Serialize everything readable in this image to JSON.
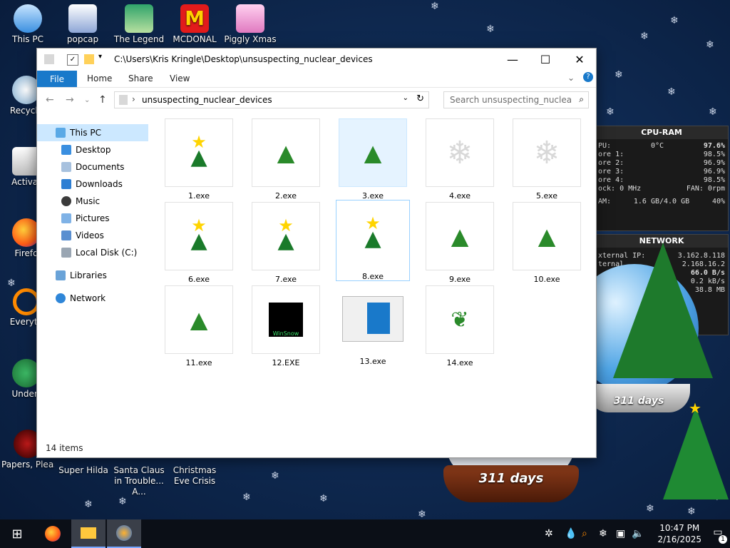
{
  "desktop_icons": [
    {
      "label": "This PC"
    },
    {
      "label": "popcap"
    },
    {
      "label": "The Legend"
    },
    {
      "label": "MCDONAL"
    },
    {
      "label": "Piggly Xmas"
    },
    {
      "label": "Recycle"
    },
    {
      "label": "Activat"
    },
    {
      "label": "Firefo"
    },
    {
      "label": "Everyth"
    },
    {
      "label": "Undert"
    },
    {
      "label": "Papers, Please"
    },
    {
      "label": "Super Hilda"
    },
    {
      "label": "Santa Claus in Trouble... A..."
    },
    {
      "label": "Christmas Eve Crisis"
    }
  ],
  "window": {
    "title_path": "C:\\Users\\Kris Kringle\\Desktop\\unsuspecting_nuclear_devices",
    "ribbon_tabs": [
      "File",
      "Home",
      "Share",
      "View"
    ],
    "address": "unsuspecting_nuclear_devices",
    "search_placeholder": "Search unsuspecting_nuclear_...",
    "nav": {
      "this_pc": "This PC",
      "desktop": "Desktop",
      "documents": "Documents",
      "downloads": "Downloads",
      "music": "Music",
      "pictures": "Pictures",
      "videos": "Videos",
      "local_disk": "Local Disk (C:)",
      "libraries": "Libraries",
      "network": "Network"
    },
    "files": [
      {
        "name": "1.exe",
        "icon": "star-tree"
      },
      {
        "name": "2.exe",
        "icon": "xmas-tree"
      },
      {
        "name": "3.exe",
        "icon": "xmas-tree"
      },
      {
        "name": "4.exe",
        "icon": "snowflake"
      },
      {
        "name": "5.exe",
        "icon": "snowflake"
      },
      {
        "name": "6.exe",
        "icon": "star-tree"
      },
      {
        "name": "7.exe",
        "icon": "star-tree"
      },
      {
        "name": "8.exe",
        "icon": "star-tree"
      },
      {
        "name": "9.exe",
        "icon": "xmas-tree"
      },
      {
        "name": "10.exe",
        "icon": "xmas-tree"
      },
      {
        "name": "11.exe",
        "icon": "xmas-tree"
      },
      {
        "name": "12.EXE",
        "icon": "winsnow"
      },
      {
        "name": "13.exe",
        "icon": "window-thumb"
      },
      {
        "name": "14.exe",
        "icon": "holly"
      }
    ],
    "status": "14 items",
    "winsnow_label": "WinSnow"
  },
  "cpu_gadget": {
    "title": "CPU-RAM",
    "rows": [
      {
        "l": "PU:",
        "m": "0°C",
        "r": "97.6%"
      },
      {
        "l": "ore 1:",
        "m": "",
        "r": "98.5%"
      },
      {
        "l": "ore 2:",
        "m": "",
        "r": "96.9%"
      },
      {
        "l": "ore 3:",
        "m": "",
        "r": "96.9%"
      },
      {
        "l": "ore 4:",
        "m": "",
        "r": "98.5%"
      },
      {
        "l": "ock: 0 MHz",
        "m": "",
        "r": "FAN: 0rpm"
      },
      {
        "l": "AM:",
        "m": "1.6 GB/4.0 GB",
        "r": "40%"
      }
    ]
  },
  "net_gadget": {
    "title": "NETWORK",
    "rows": [
      {
        "l": "xternal IP:",
        "r": "3.162.8.118"
      },
      {
        "l": "ternal",
        "r": "2.168.16.2"
      },
      {
        "l": "",
        "r": "66.0 B/s"
      },
      {
        "l": "",
        "r": "0.2 kB/s"
      },
      {
        "l": "",
        "r": "38.8 MB"
      }
    ]
  },
  "globes": {
    "days_text": "311 days"
  },
  "taskbar": {
    "time": "10:47 PM",
    "date": "2/16/2025",
    "notif_count": "1"
  }
}
